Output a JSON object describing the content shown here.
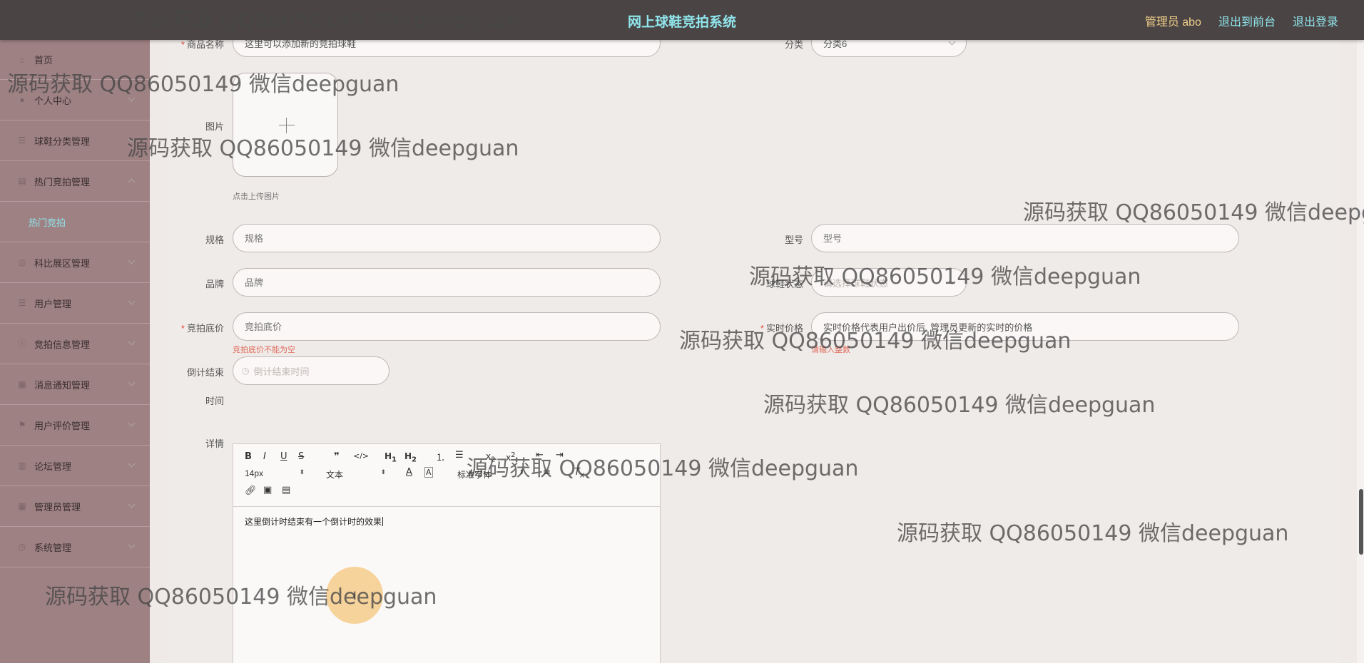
{
  "header": {
    "title": "网上球鞋竞拍系统",
    "admin_label": "管理员 abo",
    "to_frontend": "退出到前台",
    "logout": "退出登录"
  },
  "sidebar": {
    "items": [
      {
        "label": "首页",
        "icon": "home-icon"
      },
      {
        "label": "个人中心",
        "icon": "user-icon"
      },
      {
        "label": "球鞋分类管理",
        "icon": "list-icon"
      },
      {
        "label": "热门竞拍管理",
        "icon": "doc-icon"
      },
      {
        "label": "热门竞拍",
        "icon": ""
      },
      {
        "label": "科比展区管理",
        "icon": "circle-icon"
      },
      {
        "label": "用户管理",
        "icon": "list-icon"
      },
      {
        "label": "竞拍信息管理",
        "icon": "info-icon"
      },
      {
        "label": "消息通知管理",
        "icon": "grid-icon"
      },
      {
        "label": "用户评价管理",
        "icon": "flag-icon"
      },
      {
        "label": "论坛管理",
        "icon": "book-icon"
      },
      {
        "label": "管理员管理",
        "icon": "grid-icon"
      },
      {
        "label": "系统管理",
        "icon": "clock-icon"
      }
    ]
  },
  "form": {
    "product_name": {
      "label": "商品名称",
      "value": "这里可以添加新的竞拍球鞋"
    },
    "category": {
      "label": "分类",
      "value": "分类6"
    },
    "image": {
      "label": "图片",
      "hint": "点击上传图片"
    },
    "spec": {
      "label": "规格",
      "placeholder": "规格"
    },
    "model": {
      "label": "型号",
      "placeholder": "型号"
    },
    "brand": {
      "label": "品牌",
      "placeholder": "品牌"
    },
    "status": {
      "label": "球鞋状态",
      "placeholder": "请选择球鞋状态"
    },
    "base_price": {
      "label": "竞拍底价",
      "placeholder": "竞拍底价",
      "error": "竞拍底价不能为空"
    },
    "live_price": {
      "label": "实时价格",
      "value": "实时价格代表用户出价后, 管理员更新的实时的价格",
      "error": "请输入整数"
    },
    "countdown": {
      "label_line1": "倒计结束",
      "label_line2": "时间",
      "placeholder": "倒计结束时间"
    },
    "details": {
      "label": "详情"
    }
  },
  "editor": {
    "font_size": "14px",
    "text_type": "文本",
    "font_family": "标准字体",
    "content": "这里倒计时结束有一个倒计时的效果"
  },
  "watermark": "源码获取 QQ86050149 微信deepguan",
  "colors": {
    "topbar": "#4b4444",
    "sidebar": "#9e8183",
    "accent_cyan": "#8fe6ec",
    "accent_gold": "#f0d08a",
    "error": "#e06c5c"
  }
}
